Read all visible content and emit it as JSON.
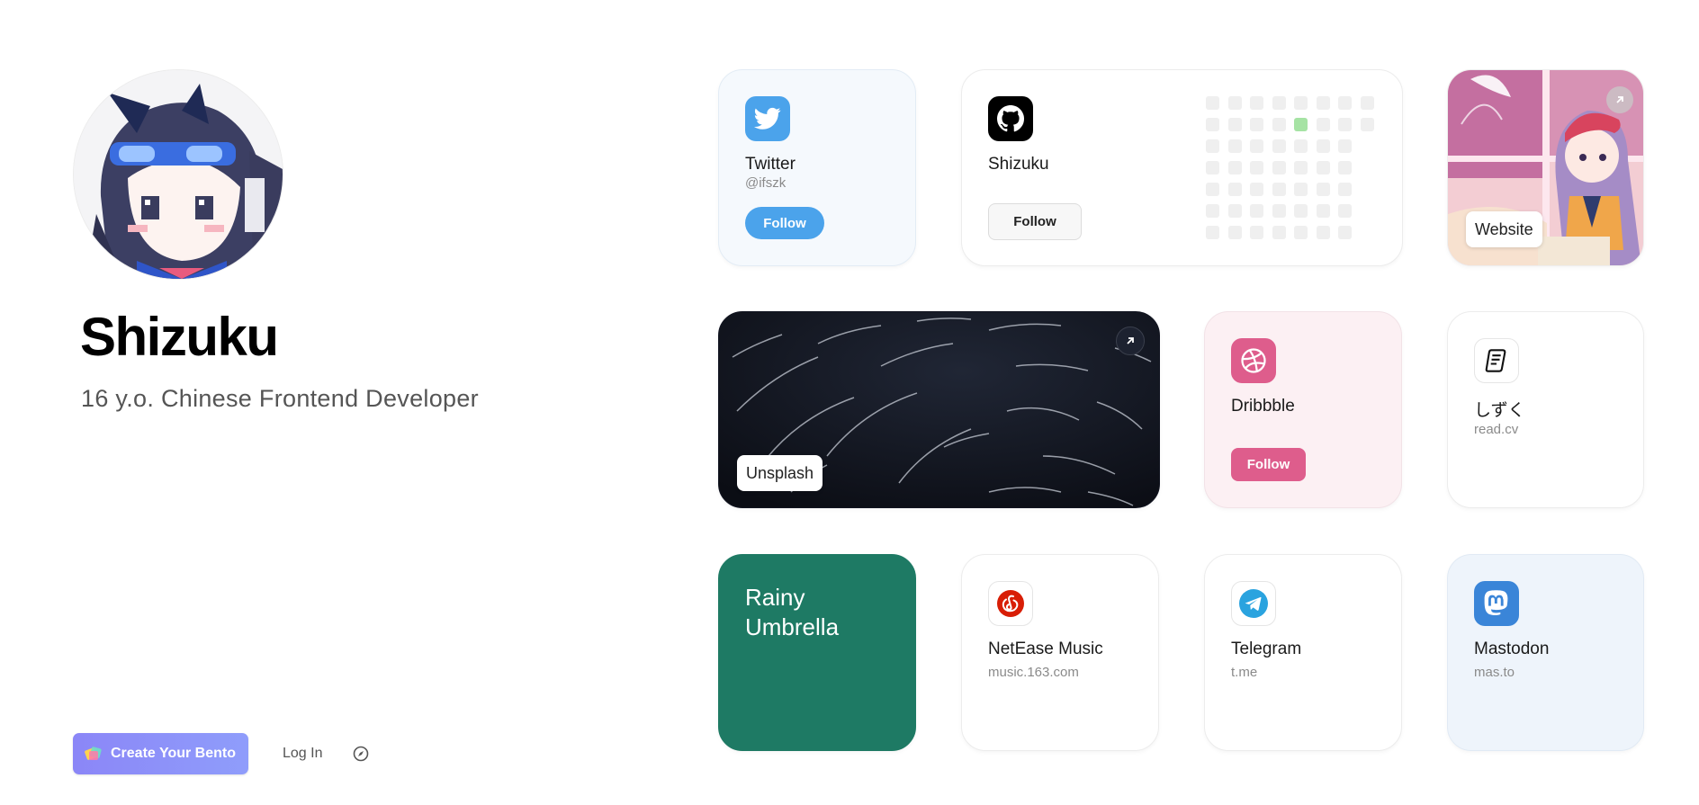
{
  "profile": {
    "name": "Shizuku",
    "bio": "16 y.o. Chinese Frontend Developer"
  },
  "footer": {
    "create_label": "Create Your Bento",
    "login_label": "Log In"
  },
  "cards": {
    "twitter": {
      "title": "Twitter",
      "handle": "@ifszk",
      "button": "Follow"
    },
    "github": {
      "title": "Shizuku",
      "button": "Follow"
    },
    "website": {
      "label": "Website"
    },
    "unsplash": {
      "label": "Unsplash"
    },
    "dribbble": {
      "title": "Dribbble",
      "button": "Follow"
    },
    "readcv": {
      "title": "しずく",
      "sub": "read.cv"
    },
    "rainy": {
      "line1": "Rainy",
      "line2": "Umbrella"
    },
    "netease": {
      "title": "NetEase Music",
      "sub": "music.163.com"
    },
    "telegram": {
      "title": "Telegram",
      "sub": "t.me"
    },
    "mastodon": {
      "title": "Mastodon",
      "sub": "mas.to"
    }
  },
  "icons": {
    "twitter": "twitter-bird-icon",
    "github": "github-icon",
    "dribbble": "dribbble-ball-icon",
    "readcv": "document-icon",
    "netease": "netease-music-icon",
    "telegram": "paper-plane-icon",
    "mastodon": "mastodon-icon",
    "external": "arrow-up-right-icon",
    "compass": "compass-icon"
  },
  "colors": {
    "twitter_blue": "#4ba3eb",
    "twitter_bg": "#f5f9fd",
    "dribbble_pink": "#de5d8c",
    "dribbble_bg": "#fcf0f3",
    "rainy_green": "#1e7a64",
    "netease_red": "#d81e06",
    "telegram_blue": "#2aa3df",
    "mastodon_blue": "#3a85d8",
    "mastodon_bg": "#eef4fb",
    "bento_purple": "#8b86f7",
    "contribution_green": "#a6e3a4"
  }
}
